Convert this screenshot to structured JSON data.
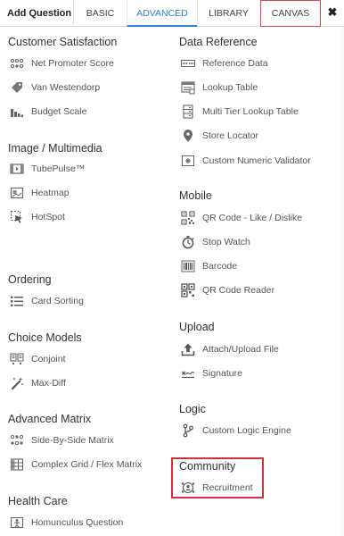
{
  "header": {
    "title": "Add Question",
    "tabs": [
      {
        "label": "BASIC"
      },
      {
        "label": "ADVANCED"
      },
      {
        "label": "LIBRARY"
      },
      {
        "label": "CANVAS"
      }
    ],
    "close_label": "✖"
  },
  "left": {
    "customer_satisfaction": {
      "heading": "Customer Satisfaction",
      "items": [
        "Net Promoter Score",
        "Van Westendorp",
        "Budget Scale"
      ]
    },
    "image_multimedia": {
      "heading": "Image / Multimedia",
      "items": [
        "TubePulse™",
        "Heatmap",
        "HotSpot"
      ]
    },
    "ordering": {
      "heading": "Ordering",
      "items": [
        "Card Sorting"
      ]
    },
    "choice_models": {
      "heading": "Choice Models",
      "items": [
        "Conjoint",
        "Max-Diff"
      ]
    },
    "advanced_matrix": {
      "heading": "Advanced Matrix",
      "items": [
        "Side-By-Side Matrix",
        "Complex Grid / Flex Matrix"
      ]
    },
    "health_care": {
      "heading": "Health Care",
      "items": [
        "Homunculus Question"
      ]
    }
  },
  "right": {
    "data_reference": {
      "heading": "Data Reference",
      "items": [
        "Reference Data",
        "Lookup Table",
        "Multi Tier Lookup Table",
        "Store Locator",
        "Custom Numeric Validator"
      ]
    },
    "mobile": {
      "heading": "Mobile",
      "items": [
        "QR Code - Like / Dislike",
        "Stop Watch",
        "Barcode",
        "QR Code Reader"
      ]
    },
    "upload": {
      "heading": "Upload",
      "items": [
        "Attach/Upload File",
        "Signature"
      ]
    },
    "logic": {
      "heading": "Logic",
      "items": [
        "Custom Logic Engine"
      ]
    },
    "community": {
      "heading": "Community",
      "items": [
        "Recruitment"
      ]
    }
  },
  "colors": {
    "accent": "#2f7fd6",
    "highlight_border": "#d42f3d",
    "icon": "#666666"
  }
}
